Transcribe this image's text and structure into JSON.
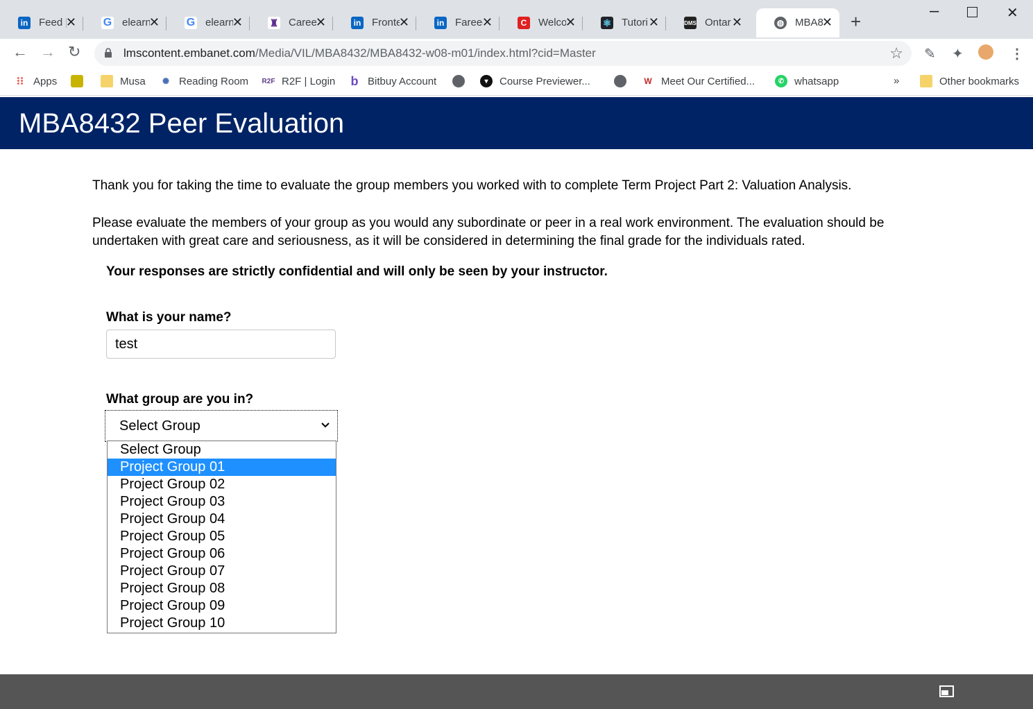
{
  "browser": {
    "tabs": [
      {
        "title": "Feed |",
        "icon": "linkedin-icon"
      },
      {
        "title": "elearn",
        "icon": "google-icon"
      },
      {
        "title": "elearn",
        "icon": "google-icon"
      },
      {
        "title": "Career",
        "icon": "university-icon"
      },
      {
        "title": "Fronte",
        "icon": "linkedin-icon"
      },
      {
        "title": "Fareed",
        "icon": "linkedin-icon"
      },
      {
        "title": "Welco",
        "icon": "c-icon"
      },
      {
        "title": "Tutori",
        "icon": "react-icon"
      },
      {
        "title": "Ontar",
        "icon": "dms-icon"
      },
      {
        "title": "MBA8",
        "icon": "globe-icon"
      }
    ],
    "url_host": "lmscontent.embanet.com",
    "url_path": "/Media/VIL/MBA8432/MBA8432-w08-m01/index.html?cid=Master",
    "bookmarks": {
      "apps": "Apps",
      "musa": "Musa",
      "reading_room": "Reading Room",
      "r2f": "R2F | Login",
      "bitbuy": "Bitbuy Account",
      "course_previewer": "Course Previewer...",
      "meet_certified": "Meet Our Certified...",
      "whatsapp": "whatsapp",
      "more": "»",
      "other": "Other bookmarks"
    }
  },
  "page": {
    "title": "MBA8432 Peer Evaluation",
    "intro": "Thank you for taking the time to evaluate the group members you worked with to complete Term Project Part 2: Valuation Analysis.",
    "instructions": "Please evaluate the members of your group as you would any subordinate or peer in a real work environment. The evaluation should be undertaken with great care and seriousness, as it will be considered in determining the final grade for the individuals rated.",
    "confidential": "Your responses are strictly confidential and will only be seen by your instructor.",
    "name_question": "What is your name?",
    "name_value": "test",
    "group_question": "What group are you in?",
    "group_selected": "Select Group",
    "group_options": [
      "Select Group",
      "Project Group 01",
      "Project Group 02",
      "Project Group 03",
      "Project Group 04",
      "Project Group 05",
      "Project Group 06",
      "Project Group 07",
      "Project Group 08",
      "Project Group 09",
      "Project Group 10"
    ],
    "highlighted_option": "Project Group 01"
  },
  "colors": {
    "header_bg": "#002366",
    "highlight": "#1e90ff",
    "footer_bg": "#555555"
  }
}
